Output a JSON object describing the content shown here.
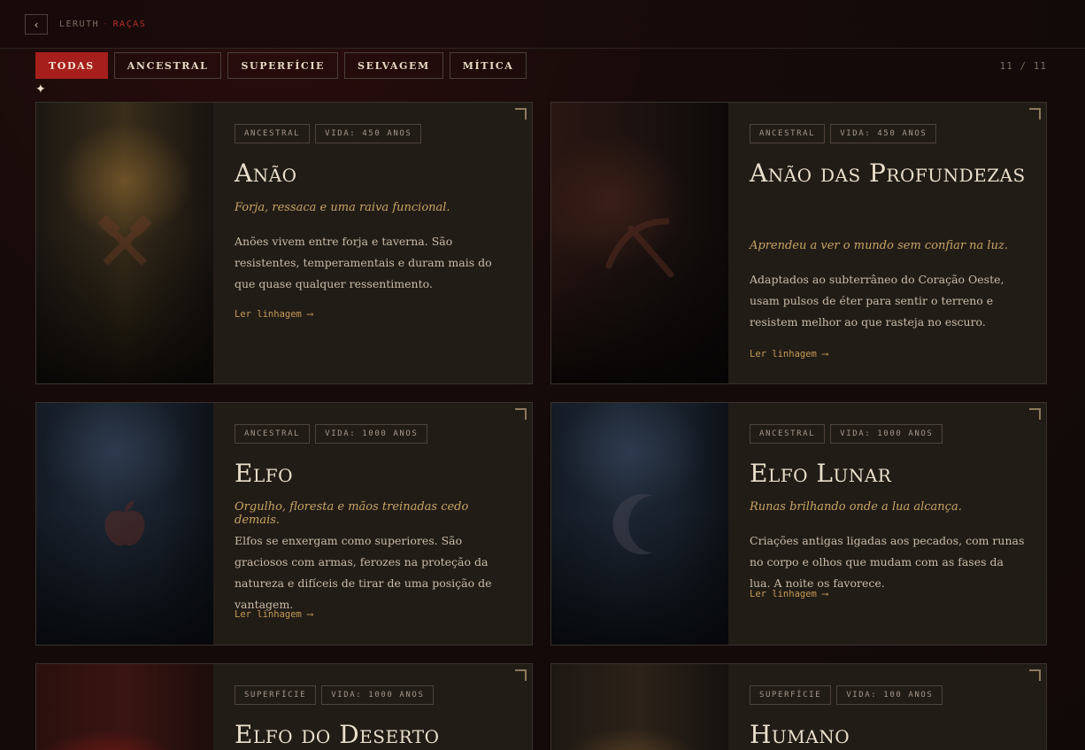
{
  "header": {
    "back_label": "‹",
    "breadcrumb": [
      "LERUTH",
      "RAÇAS"
    ],
    "breadcrumb_sep": "·"
  },
  "filters": [
    {
      "label": "TODAS",
      "active": true
    },
    {
      "label": "ANCESTRAL",
      "active": false
    },
    {
      "label": "SUPERFÍCIE",
      "active": false
    },
    {
      "label": "SELVAGEM",
      "active": false
    },
    {
      "label": "MÍTICA",
      "active": false
    }
  ],
  "counter": "11 / 11",
  "sparkle": "✦",
  "cards": [
    {
      "tags": [
        "ANCESTRAL",
        "VIDA: 450 ANOS"
      ],
      "title": "Anão",
      "tagline": "Forja, ressaca e uma raiva funcional.",
      "description": "Anões vivem entre forja e taverna. São resistentes, temperamentais e duram mais do que quase qualquer ressentimento.",
      "link": "Ler linhagem ⟶",
      "icon": "crossed-hammers-icon"
    },
    {
      "tags": [
        "ANCESTRAL",
        "VIDA: 450 ANOS"
      ],
      "title": "Anão das Profundezas",
      "tagline": "Aprendeu a ver o mundo sem confiar na luz.",
      "description": "Adaptados ao subterrâneo do Coração Oeste, usam pulsos de éter para sentir o terreno e resistem melhor ao que rasteja no escuro.",
      "link": "Ler linhagem ⟶",
      "icon": "pickaxe-icon"
    },
    {
      "tags": [
        "ANCESTRAL",
        "VIDA: 1000 ANOS"
      ],
      "title": "Elfo",
      "tagline": "Orgulho, floresta e mãos treinadas cedo demais.",
      "description": "Elfos se enxergam como superiores. São graciosos com armas, ferozes na proteção da natureza e difíceis de tirar de uma posição de vantagem.",
      "link": "Ler linhagem ⟶",
      "icon": "apple-icon"
    },
    {
      "tags": [
        "ANCESTRAL",
        "VIDA: 1000 ANOS"
      ],
      "title": "Elfo Lunar",
      "tagline": "Runas brilhando onde a lua alcança.",
      "description": "Criações antigas ligadas aos pecados, com runas no corpo e olhos que mudam com as fases da lua. A noite os favorece.",
      "link": "Ler linhagem ⟶",
      "icon": "crescent-moon-icon"
    },
    {
      "tags": [
        "SUPERFÍCIE",
        "VIDA: 1000 ANOS"
      ],
      "title": "Elfo do Deserto",
      "icon": "desert-icon"
    },
    {
      "tags": [
        "SUPERFÍCIE",
        "VIDA: 100 ANOS"
      ],
      "title": "Humano",
      "icon": "human-icon"
    }
  ],
  "colors": {
    "accent_red": "#a71f1c",
    "gold": "#c9a463",
    "link": "#c49a55"
  }
}
